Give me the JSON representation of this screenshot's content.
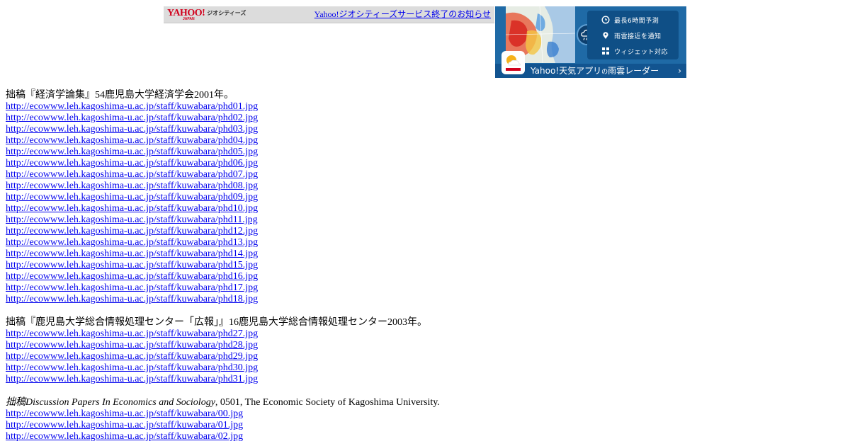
{
  "geo_bar": {
    "logo_text": "YAHOO!",
    "logo_sub": "JAPAN",
    "service_name": "ジオシティーズ",
    "notice_link": "Yahoo!ジオシティーズサービス終了のお知らせ"
  },
  "ad": {
    "features": [
      "最長6時間予測",
      "雨雲接近を通知",
      "ウィジェット対応"
    ],
    "cta_main": "Yahoo!天気アプリ",
    "cta_connector": "の",
    "cta_tail": "雨雲レーダー",
    "chevron": "›",
    "colors": {
      "background": "#1f6aa6",
      "panel": "#0f4f86",
      "footer": "#125490"
    }
  },
  "sections": [
    {
      "heading": "拙稿『経済学論集』54鹿児島大学経済学会2001年。",
      "links": [
        "http://ecowww.leh.kagoshima-u.ac.jp/staff/kuwabara/phd01.jpg",
        "http://ecowww.leh.kagoshima-u.ac.jp/staff/kuwabara/phd02.jpg",
        "http://ecowww.leh.kagoshima-u.ac.jp/staff/kuwabara/phd03.jpg",
        "http://ecowww.leh.kagoshima-u.ac.jp/staff/kuwabara/phd04.jpg",
        "http://ecowww.leh.kagoshima-u.ac.jp/staff/kuwabara/phd05.jpg",
        "http://ecowww.leh.kagoshima-u.ac.jp/staff/kuwabara/phd06.jpg",
        "http://ecowww.leh.kagoshima-u.ac.jp/staff/kuwabara/phd07.jpg",
        "http://ecowww.leh.kagoshima-u.ac.jp/staff/kuwabara/phd08.jpg",
        "http://ecowww.leh.kagoshima-u.ac.jp/staff/kuwabara/phd09.jpg",
        "http://ecowww.leh.kagoshima-u.ac.jp/staff/kuwabara/phd10.jpg",
        "http://ecowww.leh.kagoshima-u.ac.jp/staff/kuwabara/phd11.jpg",
        "http://ecowww.leh.kagoshima-u.ac.jp/staff/kuwabara/phd12.jpg",
        "http://ecowww.leh.kagoshima-u.ac.jp/staff/kuwabara/phd13.jpg",
        "http://ecowww.leh.kagoshima-u.ac.jp/staff/kuwabara/phd14.jpg",
        "http://ecowww.leh.kagoshima-u.ac.jp/staff/kuwabara/phd15.jpg",
        "http://ecowww.leh.kagoshima-u.ac.jp/staff/kuwabara/phd16.jpg",
        "http://ecowww.leh.kagoshima-u.ac.jp/staff/kuwabara/phd17.jpg",
        "http://ecowww.leh.kagoshima-u.ac.jp/staff/kuwabara/phd18.jpg"
      ]
    },
    {
      "heading": "拙稿『鹿児島大学総合情報処理センター「広報」』16鹿児島大学総合情報処理センター2003年。",
      "links": [
        "http://ecowww.leh.kagoshima-u.ac.jp/staff/kuwabara/phd27.jpg",
        "http://ecowww.leh.kagoshima-u.ac.jp/staff/kuwabara/phd28.jpg",
        "http://ecowww.leh.kagoshima-u.ac.jp/staff/kuwabara/phd29.jpg",
        "http://ecowww.leh.kagoshima-u.ac.jp/staff/kuwabara/phd30.jpg",
        "http://ecowww.leh.kagoshima-u.ac.jp/staff/kuwabara/phd31.jpg"
      ]
    },
    {
      "heading_italic": "拙稿Discussion Papers In Economics and Sociology",
      "heading_rest": ", 0501, The Economic Society of Kagoshima University.",
      "links": [
        "http://ecowww.leh.kagoshima-u.ac.jp/staff/kuwabara/00.jpg",
        "http://ecowww.leh.kagoshima-u.ac.jp/staff/kuwabara/01.jpg",
        "http://ecowww.leh.kagoshima-u.ac.jp/staff/kuwabara/02.jpg"
      ]
    }
  ]
}
